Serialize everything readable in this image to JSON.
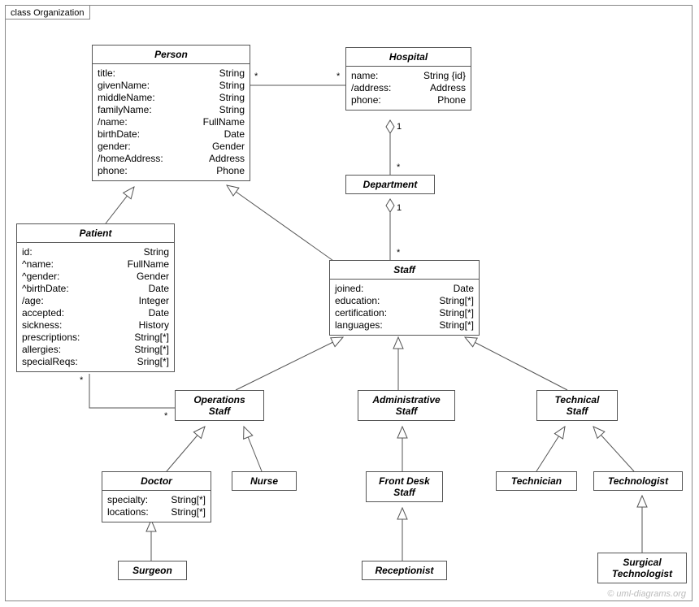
{
  "frame_label": "class Organization",
  "watermark": "© uml-diagrams.org",
  "classes": {
    "person": {
      "name": "Person",
      "attrs": [
        {
          "k": "title:",
          "t": "String"
        },
        {
          "k": "givenName:",
          "t": "String"
        },
        {
          "k": "middleName:",
          "t": "String"
        },
        {
          "k": "familyName:",
          "t": "String"
        },
        {
          "k": "/name:",
          "t": "FullName"
        },
        {
          "k": "birthDate:",
          "t": "Date"
        },
        {
          "k": "gender:",
          "t": "Gender"
        },
        {
          "k": "/homeAddress:",
          "t": "Address"
        },
        {
          "k": "phone:",
          "t": "Phone"
        }
      ]
    },
    "hospital": {
      "name": "Hospital",
      "attrs": [
        {
          "k": "name:",
          "t": "String {id}"
        },
        {
          "k": "/address:",
          "t": "Address"
        },
        {
          "k": "phone:",
          "t": "Phone"
        }
      ]
    },
    "department": {
      "name": "Department",
      "attrs": []
    },
    "patient": {
      "name": "Patient",
      "attrs": [
        {
          "k": "id:",
          "t": "String"
        },
        {
          "k": "^name:",
          "t": "FullName"
        },
        {
          "k": "^gender:",
          "t": "Gender"
        },
        {
          "k": "^birthDate:",
          "t": "Date"
        },
        {
          "k": "/age:",
          "t": "Integer"
        },
        {
          "k": "accepted:",
          "t": "Date"
        },
        {
          "k": "sickness:",
          "t": "History"
        },
        {
          "k": "prescriptions:",
          "t": "String[*]"
        },
        {
          "k": "allergies:",
          "t": "String[*]"
        },
        {
          "k": "specialReqs:",
          "t": "Sring[*]"
        }
      ]
    },
    "staff": {
      "name": "Staff",
      "attrs": [
        {
          "k": "joined:",
          "t": "Date"
        },
        {
          "k": "education:",
          "t": "String[*]"
        },
        {
          "k": "certification:",
          "t": "String[*]"
        },
        {
          "k": "languages:",
          "t": "String[*]"
        }
      ]
    },
    "ops_staff": {
      "name": "Operations\nStaff",
      "attrs": []
    },
    "admin_staff": {
      "name": "Administrative\nStaff",
      "attrs": []
    },
    "tech_staff": {
      "name": "Technical\nStaff",
      "attrs": []
    },
    "doctor": {
      "name": "Doctor",
      "attrs": [
        {
          "k": "specialty:",
          "t": "String[*]"
        },
        {
          "k": "locations:",
          "t": "String[*]"
        }
      ]
    },
    "nurse": {
      "name": "Nurse",
      "attrs": []
    },
    "front_desk": {
      "name": "Front Desk\nStaff",
      "attrs": []
    },
    "technician": {
      "name": "Technician",
      "attrs": []
    },
    "technologist": {
      "name": "Technologist",
      "attrs": []
    },
    "surgeon": {
      "name": "Surgeon",
      "attrs": []
    },
    "receptionist": {
      "name": "Receptionist",
      "attrs": []
    },
    "surg_tech": {
      "name": "Surgical\nTechnologist",
      "attrs": []
    }
  },
  "mult": {
    "m1": "*",
    "m2": "*",
    "m3": "1",
    "m4": "*",
    "m5": "1",
    "m6": "*",
    "m7": "*",
    "m8": "*"
  }
}
